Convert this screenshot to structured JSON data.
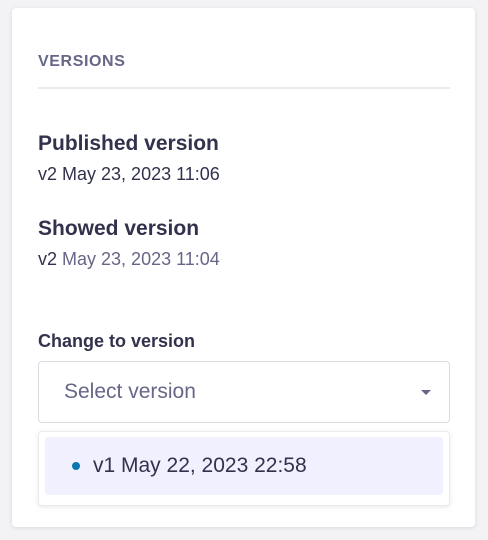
{
  "versions_panel": {
    "title": "VERSIONS",
    "published": {
      "heading": "Published version",
      "version": "v2",
      "date": "May 23, 2023 11:06"
    },
    "showed": {
      "heading": "Showed version",
      "version": "v2",
      "date": "May 23, 2023 11:04"
    },
    "change": {
      "label": "Change to version",
      "placeholder": "Select version",
      "options": [
        {
          "label": "v1 May 22, 2023 22:58",
          "status_color": "#0c75af"
        }
      ]
    }
  },
  "colors": {
    "primary_text": "#32324d",
    "muted_text": "#666687",
    "option_highlight": "#f0f0ff",
    "status_dot": "#0c75af"
  }
}
